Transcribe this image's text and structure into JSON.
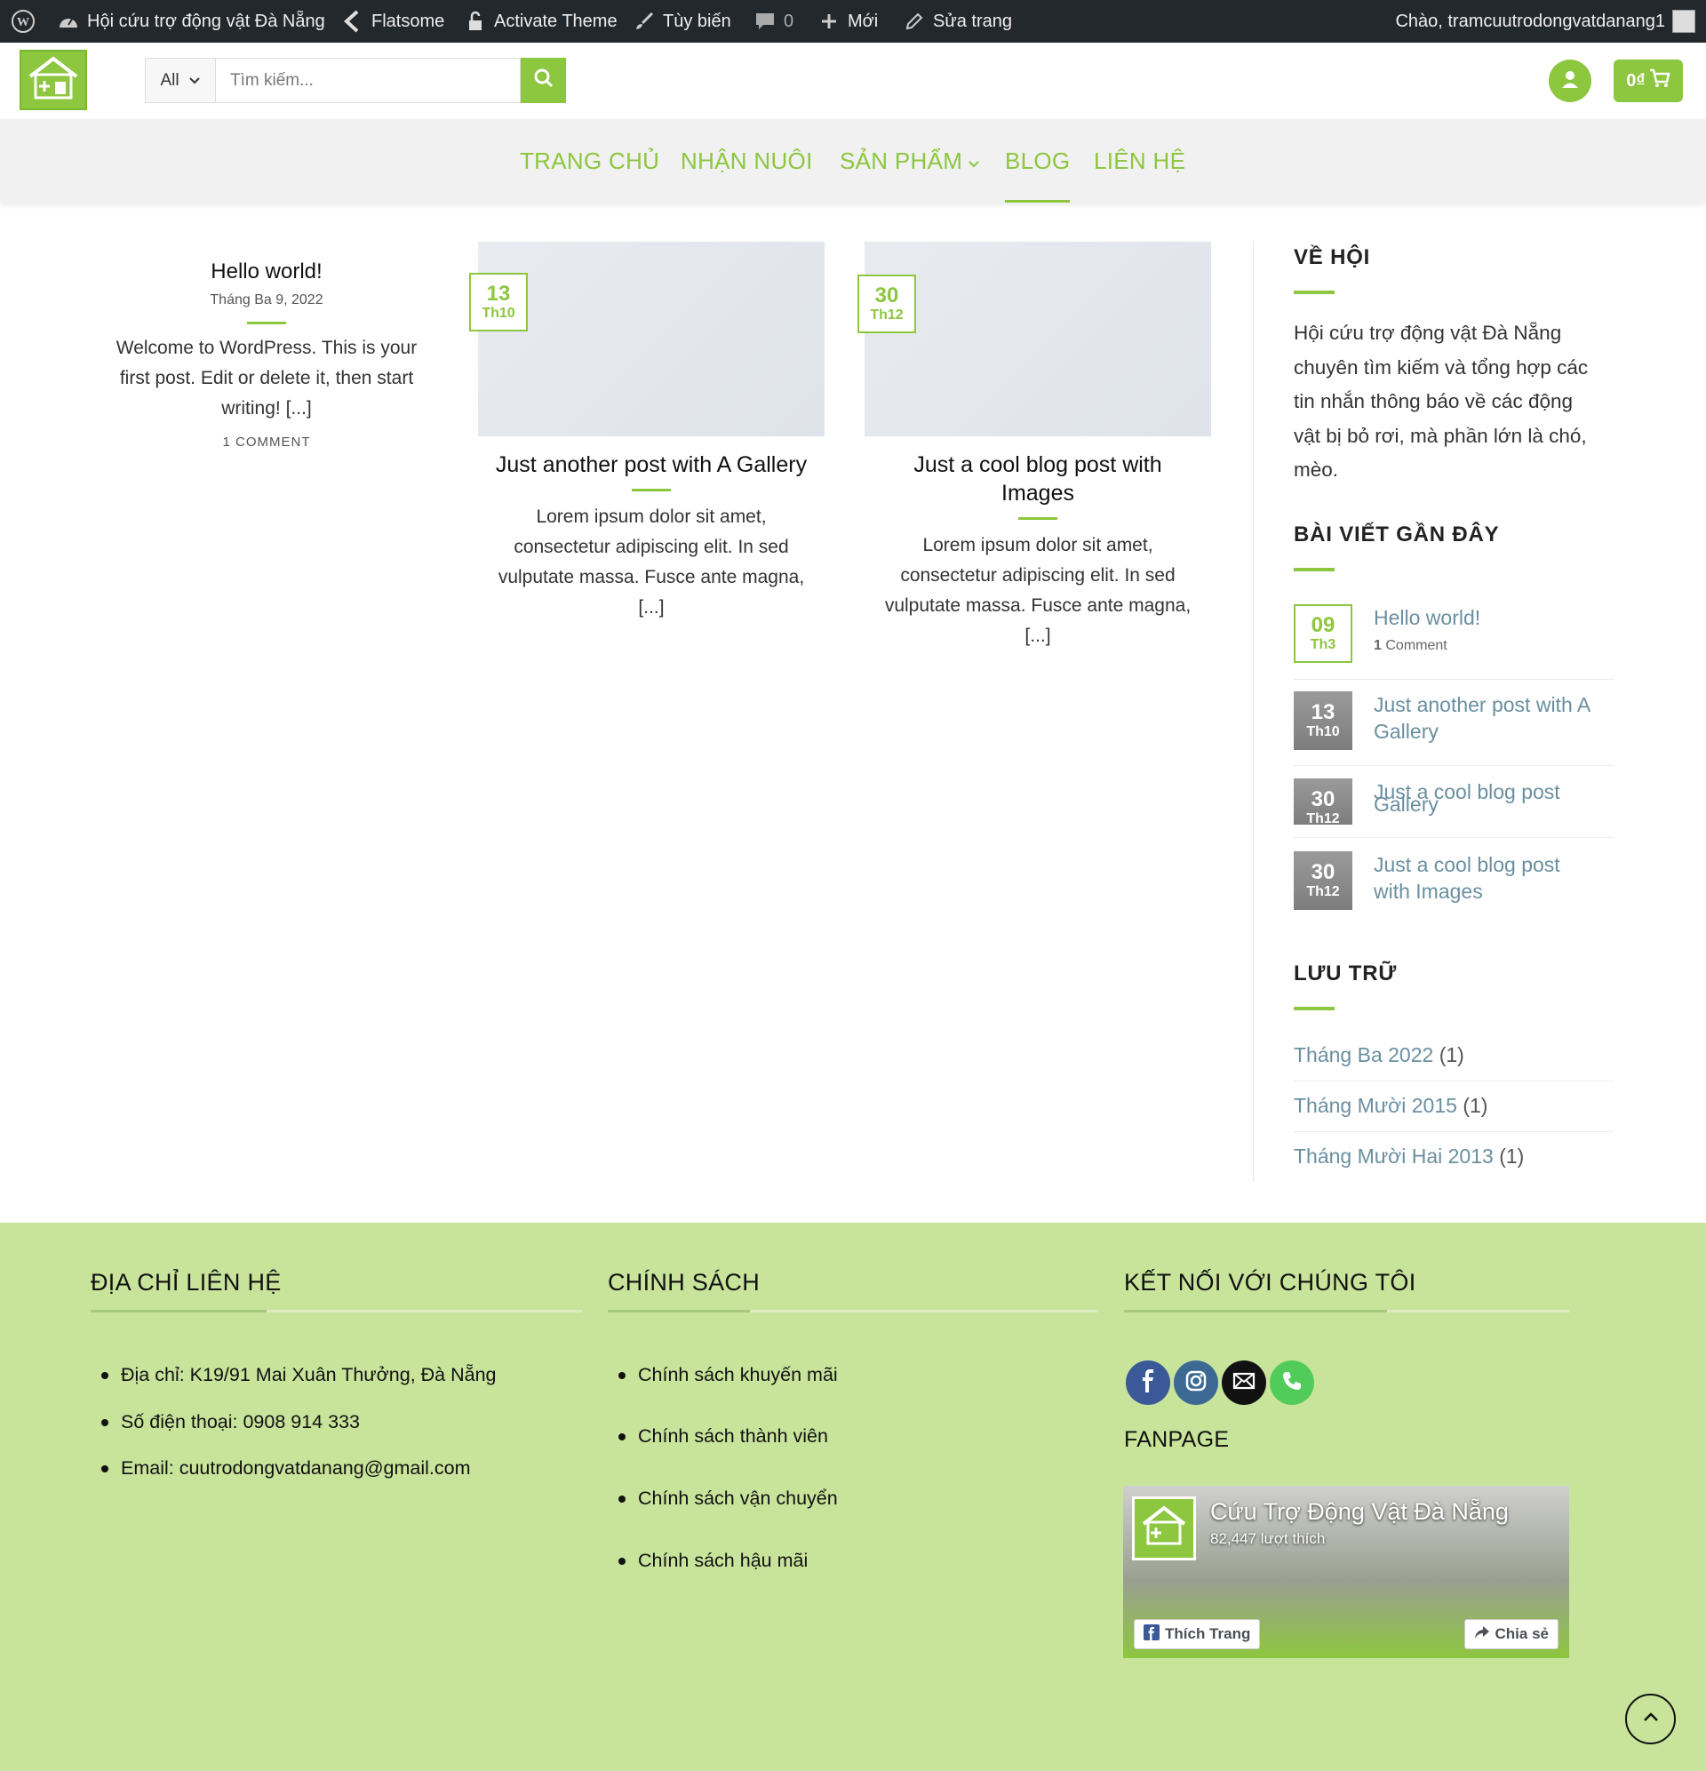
{
  "admin_bar": {
    "site_name": "Hội cứu trợ động vật Đà Nẵng",
    "theme": "Flatsome",
    "activate": "Activate Theme",
    "customize": "Tùy biến",
    "comments_count": "0",
    "new": "Mới",
    "edit": "Sửa trang",
    "greeting": "Chào, tramcuutrodongvatdanang1"
  },
  "header": {
    "search_category": "All",
    "search_placeholder": "Tìm kiếm...",
    "cart_total": "0₫"
  },
  "nav": {
    "items": [
      {
        "label": "TRANG CHỦ"
      },
      {
        "label": "NHẬN NUÔI"
      },
      {
        "label": "SẢN PHẨM"
      },
      {
        "label": "BLOG"
      },
      {
        "label": "LIÊN HỆ"
      }
    ],
    "active": "BLOG"
  },
  "posts": [
    {
      "title": "Hello world!",
      "date": "Tháng Ba 9, 2022",
      "excerpt_lines": [
        "Welcome to WordPress. This is your",
        "first post. Edit or delete it, then start",
        "writing! [...]"
      ],
      "comments": "1 COMMENT"
    },
    {
      "title": "Just another post with A Gallery",
      "day": "13",
      "month": "Th10",
      "excerpt_lines": [
        "Lorem ipsum dolor sit amet,",
        "consectetur adipiscing elit. In sed",
        "vulputate massa. Fusce ante magna,",
        "[...]"
      ]
    },
    {
      "title_lines": [
        "Just a cool blog post with",
        "Images"
      ],
      "day": "30",
      "month": "Th12",
      "excerpt_lines": [
        "Lorem ipsum dolor sit amet,",
        "consectetur adipiscing elit. In sed",
        "vulputate massa. Fusce ante magna,",
        "[...]"
      ]
    }
  ],
  "sidebar": {
    "about_title": "VỀ HỘI",
    "about_lines": [
      "Hội cứu trợ động vật Đà Nẵng",
      "chuyên tìm kiếm và tổng hợp các",
      "tin nhắn thông báo về các động",
      "vật bị bỏ rơi, mà phần lớn là chó,",
      "mèo."
    ],
    "recent_title": "BÀI VIẾT GẦN ĐÂY",
    "recent": [
      {
        "day": "09",
        "month": "Th3",
        "title": "Hello world!",
        "meta_count": "1",
        "meta_label": "Comment"
      },
      {
        "day": "13",
        "month": "Th10",
        "title_lines": [
          "Just another post with A",
          "Gallery"
        ]
      },
      {
        "day": "30",
        "month": "Th12",
        "title_lines": [
          "Just a cool blog post",
          "Gallery"
        ]
      },
      {
        "day": "30",
        "month": "Th12",
        "title_lines": [
          "Just a cool blog post",
          "with Images"
        ]
      }
    ],
    "archive_title": "LƯU TRỮ",
    "archives": [
      {
        "label": "Tháng Ba 2022",
        "count": "(1)"
      },
      {
        "label": "Tháng Mười 2015",
        "count": "(1)"
      },
      {
        "label": "Tháng Mười Hai 2013",
        "count": "(1)"
      }
    ]
  },
  "footer": {
    "contact_title": "ĐỊA CHỈ LIÊN HỆ",
    "contact_items": [
      "Địa chỉ: K19/91 Mai Xuân Thưởng, Đà Nẵng",
      "Số điện thoại: 0908 914 333",
      "Email: cuutrodongvatdanang@gmail.com"
    ],
    "policy_title": "CHÍNH SÁCH",
    "policy_items": [
      "Chính sách khuyến mãi",
      "Chính sách thành viên",
      "Chính sách vận chuyển",
      "Chính sách hậu mãi"
    ],
    "connect_title": "KẾT NỐI VỚI CHÚNG TÔI",
    "social_icons": [
      "facebook-icon",
      "instagram-icon",
      "email-icon",
      "phone-icon"
    ],
    "fanpage_title": "FANPAGE",
    "fanpage_name": "Cứu Trợ Động Vật Đà Nẵng",
    "fanpage_likes": "82,447 lượt thích",
    "fanpage_like_btn": "Thích Trang",
    "fanpage_share_btn": "Chia sẻ"
  },
  "colors": {
    "accent": "#8dc63f",
    "adminbar": "#23282d",
    "footer_bg": "#c8e49b",
    "link": "#6a8fa0"
  }
}
